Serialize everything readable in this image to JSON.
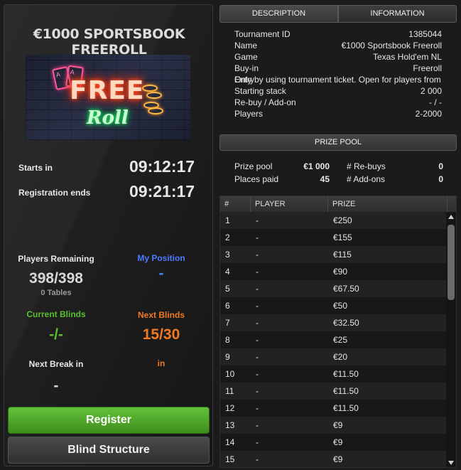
{
  "tournament_title": "€1000 SPORTSBOOK FREEROLL",
  "banner": {
    "free_text": "FREE",
    "roll_text": "Roll",
    "card_text": "A"
  },
  "starts_in": {
    "label": "Starts in",
    "value": "09:12:17"
  },
  "registration_ends": {
    "label": "Registration ends",
    "value": "09:21:17"
  },
  "players_remaining": {
    "label": "Players Remaining",
    "value": "398/398",
    "tables": "0 Tables"
  },
  "my_position": {
    "label": "My Position",
    "value": "-"
  },
  "current_blinds": {
    "label": "Current Blinds",
    "value": "-/-"
  },
  "next_blinds": {
    "label": "Next Blinds",
    "value": "15/30"
  },
  "next_break": {
    "label": "Next Break in",
    "value": "-"
  },
  "in_label": "in",
  "buttons": {
    "register": "Register",
    "blind_structure": "Blind Structure"
  },
  "tabs": [
    "DESCRIPTION",
    "INFORMATION"
  ],
  "info": {
    "tournament_id": {
      "k": "Tournament ID",
      "v": "1385044"
    },
    "name": {
      "k": "Name",
      "v": "€1000 Sportsbook Freeroll"
    },
    "game": {
      "k": "Game",
      "v": "Texas Hold'em NL"
    },
    "buy_in": {
      "k": "Buy-in",
      "v": "Freeroll"
    },
    "entry": {
      "k": "Entry",
      "v": "Only by using tournament ticket. Open for players from"
    },
    "starting_stack": {
      "k": "Starting stack",
      "v": "2 000"
    },
    "rebuy_addon": {
      "k": "Re-buy / Add-on",
      "v": "- / -"
    },
    "players": {
      "k": "Players",
      "v": "2-2000"
    }
  },
  "prize_pool": {
    "header": "PRIZE POOL",
    "prize_pool_label": "Prize pool",
    "prize_pool_value": "€1 000",
    "places_paid_label": "Places paid",
    "places_paid_value": "45",
    "rebuys_label": "# Re-buys",
    "rebuys_value": "0",
    "addons_label": "# Add-ons",
    "addons_value": "0"
  },
  "prize_table": {
    "headers": [
      "#",
      "PLAYER",
      "PRIZE"
    ],
    "rows": [
      [
        "1",
        "-",
        "€250"
      ],
      [
        "2",
        "-",
        "€155"
      ],
      [
        "3",
        "-",
        "€115"
      ],
      [
        "4",
        "-",
        "€90"
      ],
      [
        "5",
        "-",
        "€67.50"
      ],
      [
        "6",
        "-",
        "€50"
      ],
      [
        "7",
        "-",
        "€32.50"
      ],
      [
        "8",
        "-",
        "€25"
      ],
      [
        "9",
        "-",
        "€20"
      ],
      [
        "10",
        "-",
        "€11.50"
      ],
      [
        "11",
        "-",
        "€11.50"
      ],
      [
        "12",
        "-",
        "€11.50"
      ],
      [
        "13",
        "-",
        "€9"
      ],
      [
        "14",
        "-",
        "€9"
      ],
      [
        "15",
        "-",
        "€9"
      ]
    ]
  }
}
